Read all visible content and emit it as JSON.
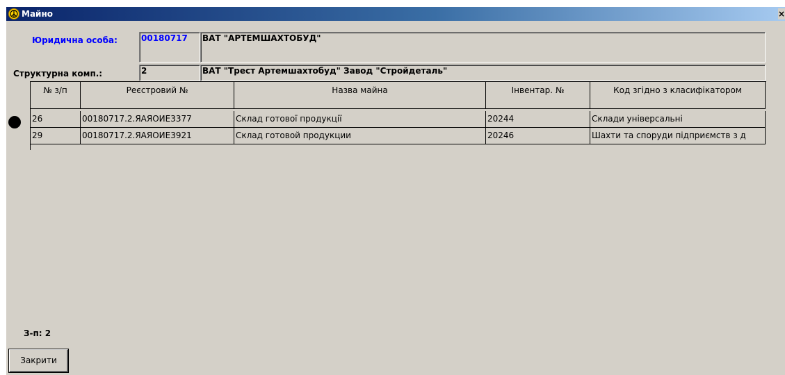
{
  "window": {
    "title": "Майно",
    "close_glyph": "×"
  },
  "header": {
    "legal_entity_label": "Юридична особа:",
    "legal_entity_code": "00180717",
    "legal_entity_name": "ВАТ \"АРТЕМШАХТОБУД\"",
    "struct_label": "Структурна комп.:",
    "struct_code": "2",
    "struct_name": "ВАТ \"Трест Артемшахтобуд\" Завод \"Стройдеталь\""
  },
  "table": {
    "columns": [
      "№ з/п",
      "Реєстровий №",
      "Назва майна",
      "Інвентар. №",
      "Код згідно з класифікатором"
    ],
    "rows": [
      [
        "26",
        "00180717.2.ЯАЯОИЕ3377",
        "Склад готової продукції",
        "20244",
        "Склади універсальні"
      ],
      [
        "29",
        "00180717.2.ЯАЯОИЕ3921",
        "Склад готовой продукции",
        "20246",
        "Шахти та споруди підприємств з д"
      ]
    ]
  },
  "footer": {
    "count_text": "З-п: 2",
    "close_button": "Закрити"
  },
  "icons": {
    "title_icon": "peace-sign-icon",
    "row_marker": "current-row-icon"
  }
}
